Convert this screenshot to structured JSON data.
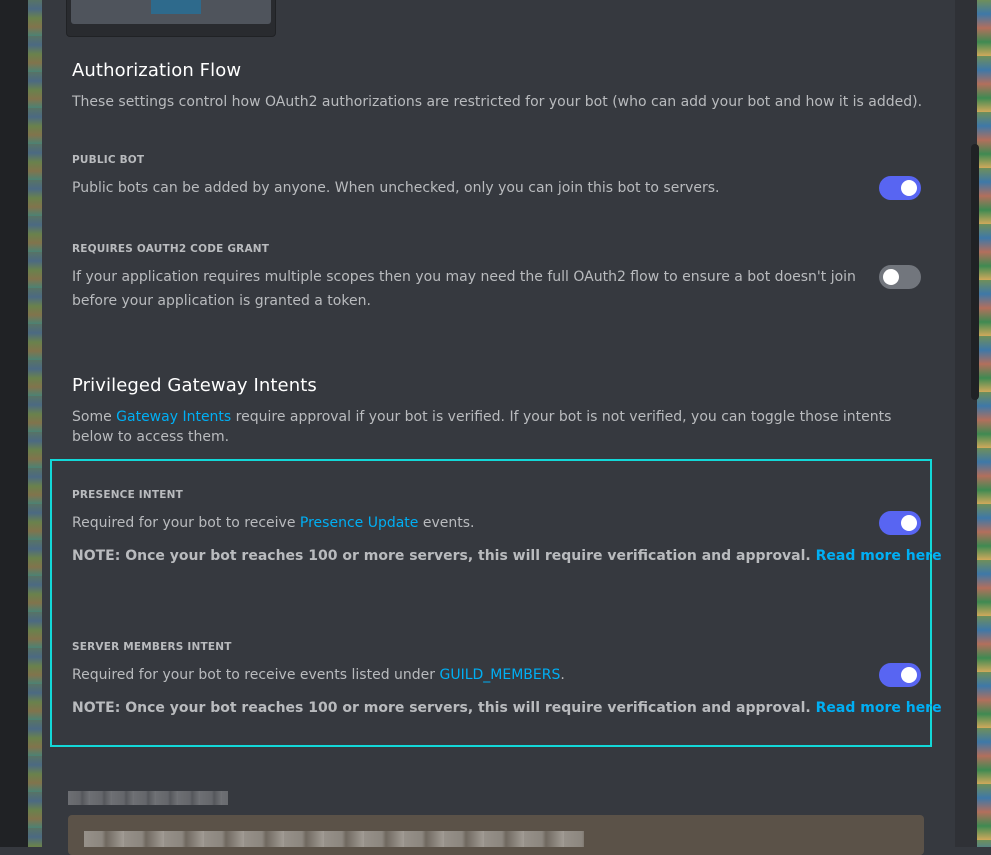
{
  "authorization_flow": {
    "title": "Authorization Flow",
    "description": "These settings control how OAuth2 authorizations are restricted for your bot (who can add your bot and how it is added).",
    "public_bot": {
      "label": "PUBLIC BOT",
      "text": "Public bots can be added by anyone. When unchecked, only you can join this bot to servers.",
      "enabled": true
    },
    "requires_code_grant": {
      "label": "REQUIRES OAUTH2 CODE GRANT",
      "text": "If your application requires multiple scopes then you may need the full OAuth2 flow to ensure a bot doesn't join before your application is granted a token.",
      "enabled": false
    }
  },
  "privileged_intents": {
    "title": "Privileged Gateway Intents",
    "description_before": "Some ",
    "description_link": "Gateway Intents",
    "description_after": " require approval if your bot is verified. If your bot is not verified, you can toggle those intents below to access them.",
    "presence": {
      "label": "PRESENCE INTENT",
      "text_before": "Required for your bot to receive ",
      "text_link": "Presence Update",
      "text_after": " events.",
      "note": "NOTE: Once your bot reaches 100 or more servers, this will require verification and approval.",
      "note_link": "Read more here",
      "enabled": true
    },
    "server_members": {
      "label": "SERVER MEMBERS INTENT",
      "text_before": "Required for your bot to receive events listed under ",
      "text_link": "GUILD_MEMBERS",
      "text_after": ".",
      "note": "NOTE: Once your bot reaches 100 or more servers, this will require verification and approval.",
      "note_link": "Read more here",
      "enabled": true
    }
  },
  "colors": {
    "background": "#36393f",
    "accent": "#5865f2",
    "link": "#00aff4",
    "highlight": "#13d8d8",
    "toggle_off": "#72767d"
  }
}
